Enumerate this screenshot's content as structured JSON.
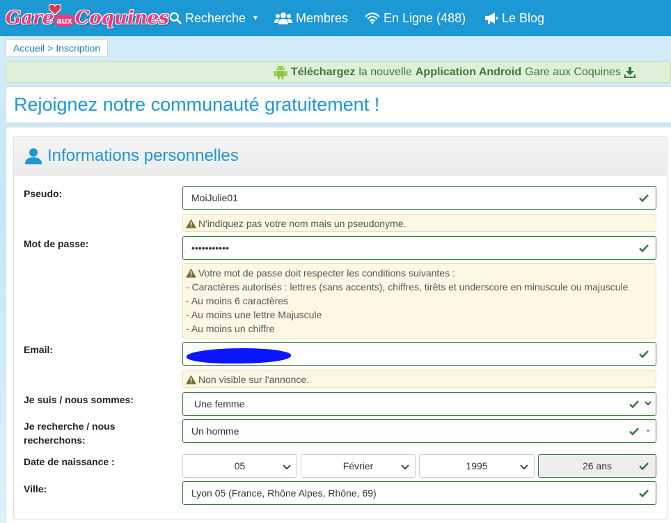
{
  "nav": {
    "logo_gare": "Gare",
    "logo_aux": "aux",
    "logo_coquines": "Coquines",
    "search": "Recherche",
    "members": "Membres",
    "online": "En Ligne (488)",
    "blog": "Le Blog"
  },
  "breadcrumb": {
    "home": "Accueil",
    "sep": ">",
    "current": "Inscription"
  },
  "banner": {
    "part1": "Téléchargez",
    "part2": "la nouvelle",
    "part3": "Application Android",
    "part4": "Gare aux Coquines"
  },
  "page_title": "Rejoignez notre communauté gratuitement !",
  "section_title": "Informations personnelles",
  "form": {
    "pseudo_label": "Pseudo:",
    "pseudo_value": "MoiJulie01",
    "pseudo_help": "N'indiquez pas votre nom mais un pseudonyme.",
    "password_label": "Mot de passe:",
    "password_value": "•••••••••••",
    "password_help": [
      "Votre mot de passe doit respecter les conditions suivantes :",
      "- Caractères autorisés : lettres (sans accents), chiffres, tirêts et underscore en minuscule ou majuscule",
      "- Au moins 6 caractères",
      "- Au moins une lettre Majuscule",
      "- Au moins un chiffre"
    ],
    "email_label": "Email:",
    "email_help": "Non visible sur l'annonce.",
    "iam_label": "Je suis / nous sommes:",
    "iam_value": "Une femme",
    "seek_label_line1": "Je recherche / nous",
    "seek_label_line2": "recherchons:",
    "seek_value": "Un homme",
    "birth_label": "Date de naissance :",
    "birth_day": "05",
    "birth_month": "Février",
    "birth_year": "1995",
    "age": "26 ans",
    "city_label": "Ville:",
    "city_value": "Lyon 05 (France, Rhône Alpes, Rhône, 69)"
  },
  "colors": {
    "navbar": "#1c98d4",
    "logo_pink": "#f03a7d",
    "success": "#3c763d",
    "warning_bg": "#fcf8e3"
  }
}
